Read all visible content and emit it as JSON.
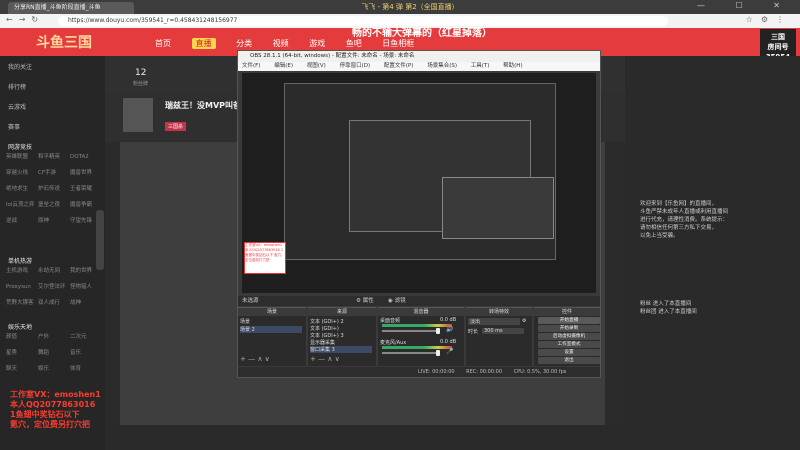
{
  "browser": {
    "tab_title": "分享RN直播_斗鱼阶段直播_斗鱼",
    "window_title": "飞飞 - 第4 弹 第2（全国直播）",
    "url": "https://www.douyu.com/359541_r=0.458431248156977",
    "window_controls": "— ☐ ✕"
  },
  "header": {
    "logo": "斗鱼三国",
    "title": "畅的不输大弹幕的（红星掉落）",
    "nav": [
      "首页",
      "直播",
      "分类",
      "视频",
      "游戏",
      "鱼吧",
      "日鱼相框"
    ],
    "active_nav": "直播",
    "right_logo_line1": "三国",
    "right_logo_line2": "房间号",
    "right_logo_line3": "35954"
  },
  "sidebar": {
    "top_items": [
      "我的关注",
      "排行榜",
      "云游戏",
      "赛事"
    ],
    "sections": [
      {
        "title": "网游竞技",
        "items": [
          "英雄联盟",
          "和平精英",
          "DOTA2",
          "穿越火线",
          "CF手游",
          "魔兽世界",
          "绝地求生",
          "炉石传说",
          "王者荣耀",
          "lol云顶之弈",
          "堡垒之夜",
          "魔兽争霸",
          "逆战",
          "原神",
          "守望先锋"
        ]
      },
      {
        "title": "单机热游",
        "items": [
          "主机游戏",
          "永劫无间",
          "我的世界",
          "Proxysun",
          "艾尔登法环",
          "怪物猎人",
          "荒野大镖客",
          "双人成行",
          "战神"
        ]
      },
      {
        "title": "娱乐天地",
        "items": [
          "颜值",
          "户外",
          "二次元",
          "星秀",
          "舞蹈",
          "音乐",
          "聊天",
          "娱乐",
          "体育"
        ]
      }
    ]
  },
  "room": {
    "count": "12",
    "count_label": "粉丝牌",
    "streamer_name": "瑞兹王！没MVP叫爸爸",
    "tag": "三国杀"
  },
  "obs": {
    "title": "OBS 28.1.1 (64-bit, windows) - 配置文件: 未命名 - 场景: 未命名",
    "menu": [
      "文件(F)",
      "编辑(E)",
      "视图(V)",
      "停靠窗口(D)",
      "配置文件(P)",
      "场景集合(S)",
      "工具(T)",
      "帮助(H)"
    ],
    "toolbar_label": "未选源",
    "toolbar_props": "属性",
    "toolbar_filters": "滤镜",
    "docks": {
      "scenes": {
        "title": "场景",
        "items": [
          "场景",
          "场景 2"
        ]
      },
      "sources": {
        "title": "来源",
        "items": [
          "文本 (GDI+) 2",
          "文本 (GDI+)",
          "文本 (GDI+) 3",
          "显示器采集",
          "窗口采集 3"
        ]
      },
      "mixer": {
        "title": "混音器",
        "tracks": [
          {
            "name": "桌面音频",
            "level": "0.0 dB"
          },
          {
            "name": "麦克风/Aux",
            "level": "0.0 dB"
          }
        ]
      },
      "transitions": {
        "title": "转场特效",
        "type": "淡出",
        "duration_label": "时长",
        "duration": "300 ms"
      },
      "controls": {
        "title": "控件",
        "buttons": [
          "开始直播",
          "开始录制",
          "启动虚拟摄像机",
          "工作室模式",
          "设置",
          "退出"
        ]
      }
    },
    "status": {
      "live": "LIVE: 00:00:00",
      "rec": "REC: 00:00:00",
      "cpu": "CPU: 0.5%, 30.00 fps"
    },
    "note_text": "工作室VX：emoshen1 本人QQ2077863016 1鱼翅中奖钻石以下 氪穴，定位费另打穴把"
  },
  "chat": {
    "lines": [
      "欢迎来到【乐鱼网】的直播间，",
      "斗鱼严禁未成年人直播或利用直播间",
      "进行代充，请理性消费。系统提示：",
      "请勿相信任何第三方私下交易，",
      "以免上当受骗。",
      "粉丝 进入了本直播间",
      "粉丝团 进入了本直播间"
    ]
  },
  "watermark": {
    "line1": "工作室VX：emoshen1",
    "line2": "本人QQ2077863016",
    "line3": "1鱼翅中奖钻石以下",
    "line4": "氪穴，定位费另打穴把"
  },
  "colors": {
    "douyu_red": "#e43c3c",
    "obs_bg": "#3a3a3a",
    "watermark": "#ff3b2f"
  }
}
